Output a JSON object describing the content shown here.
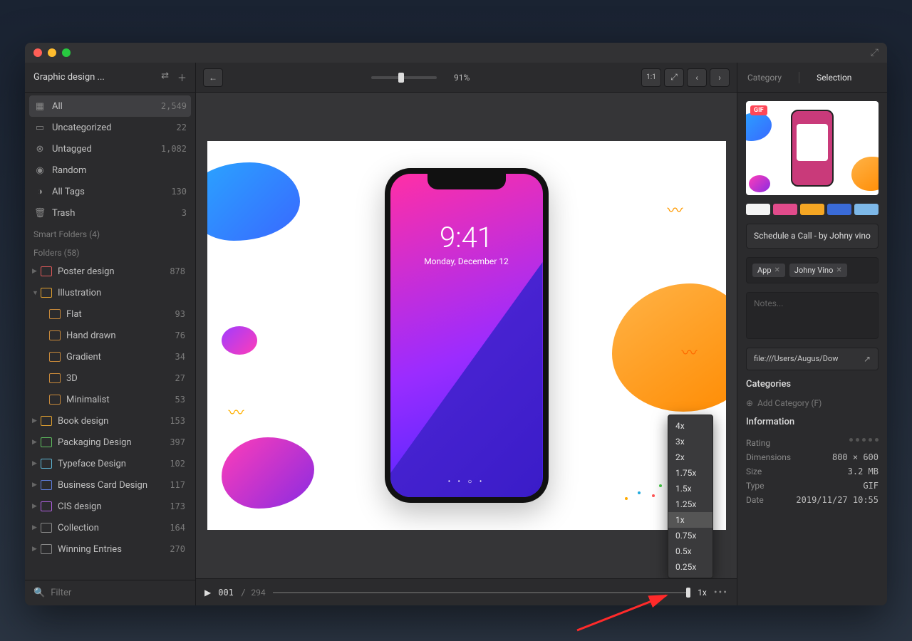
{
  "sidebar": {
    "library_name": "Graphic design ...",
    "items": [
      {
        "icon": "▦",
        "label": "All",
        "count": "2,549",
        "active": true
      },
      {
        "icon": "▭",
        "label": "Uncategorized",
        "count": "22"
      },
      {
        "icon": "⊗",
        "label": "Untagged",
        "count": "1,082"
      },
      {
        "icon": "◉",
        "label": "Random",
        "count": ""
      },
      {
        "icon": "◑",
        "label": "All Tags",
        "count": "130"
      },
      {
        "icon": "🗑",
        "label": "Trash",
        "count": "3"
      }
    ],
    "smart_folders_label": "Smart Folders (4)",
    "folders_label": "Folders (58)",
    "folders": [
      {
        "label": "Poster design",
        "count": "878",
        "color": "#e05a5a"
      },
      {
        "label": "Illustration",
        "count": "",
        "color": "#e0a030",
        "expanded": true,
        "children": [
          {
            "label": "Flat",
            "count": "93"
          },
          {
            "label": "Hand drawn",
            "count": "76"
          },
          {
            "label": "Gradient",
            "count": "34"
          },
          {
            "label": "3D",
            "count": "27"
          },
          {
            "label": "Minimalist",
            "count": "53"
          }
        ]
      },
      {
        "label": "Book design",
        "count": "153",
        "color": "#e0a030"
      },
      {
        "label": "Packaging Design",
        "count": "397",
        "color": "#5fbf5f"
      },
      {
        "label": "Typeface Design",
        "count": "102",
        "color": "#5fb8d8"
      },
      {
        "label": "Business Card Design",
        "count": "117",
        "color": "#5f7fe0"
      },
      {
        "label": "CIS design",
        "count": "173",
        "color": "#b060e0"
      },
      {
        "label": "Collection",
        "count": "164",
        "color": "#888"
      },
      {
        "label": "Winning Entries",
        "count": "270",
        "color": "#888"
      }
    ],
    "filter_placeholder": "Filter"
  },
  "toolbar": {
    "zoom_percent": "91%",
    "fit_label": "1:1"
  },
  "preview": {
    "time": "9:41",
    "date": "Monday, December 12"
  },
  "speed_menu": {
    "options": [
      "4x",
      "3x",
      "2x",
      "1.75x",
      "1.5x",
      "1.25x",
      "1x",
      "0.75x",
      "0.5x",
      "0.25x"
    ],
    "selected": "1x"
  },
  "playbar": {
    "current": "001",
    "total": "294",
    "speed": "1x"
  },
  "inspector": {
    "tab_category": "Category",
    "tab_selection": "Selection",
    "badge": "GIF",
    "swatches": [
      "#f4f4f4",
      "#e14b8b",
      "#f5a623",
      "#3a6bd8",
      "#7db8e8"
    ],
    "title": "Schedule a Call - by Johny vino",
    "tags": [
      "App",
      "Johny Vino"
    ],
    "notes_placeholder": "Notes...",
    "path": "file:///Users/Augus/Dow",
    "categories_label": "Categories",
    "add_category": "Add Category (F)",
    "information_label": "Information",
    "info": [
      {
        "k": "Rating",
        "v": ""
      },
      {
        "k": "Dimensions",
        "v": "800 × 600"
      },
      {
        "k": "Size",
        "v": "3.2 MB"
      },
      {
        "k": "Type",
        "v": "GIF"
      },
      {
        "k": "Date",
        "v": "2019/11/27 10:55"
      }
    ]
  }
}
